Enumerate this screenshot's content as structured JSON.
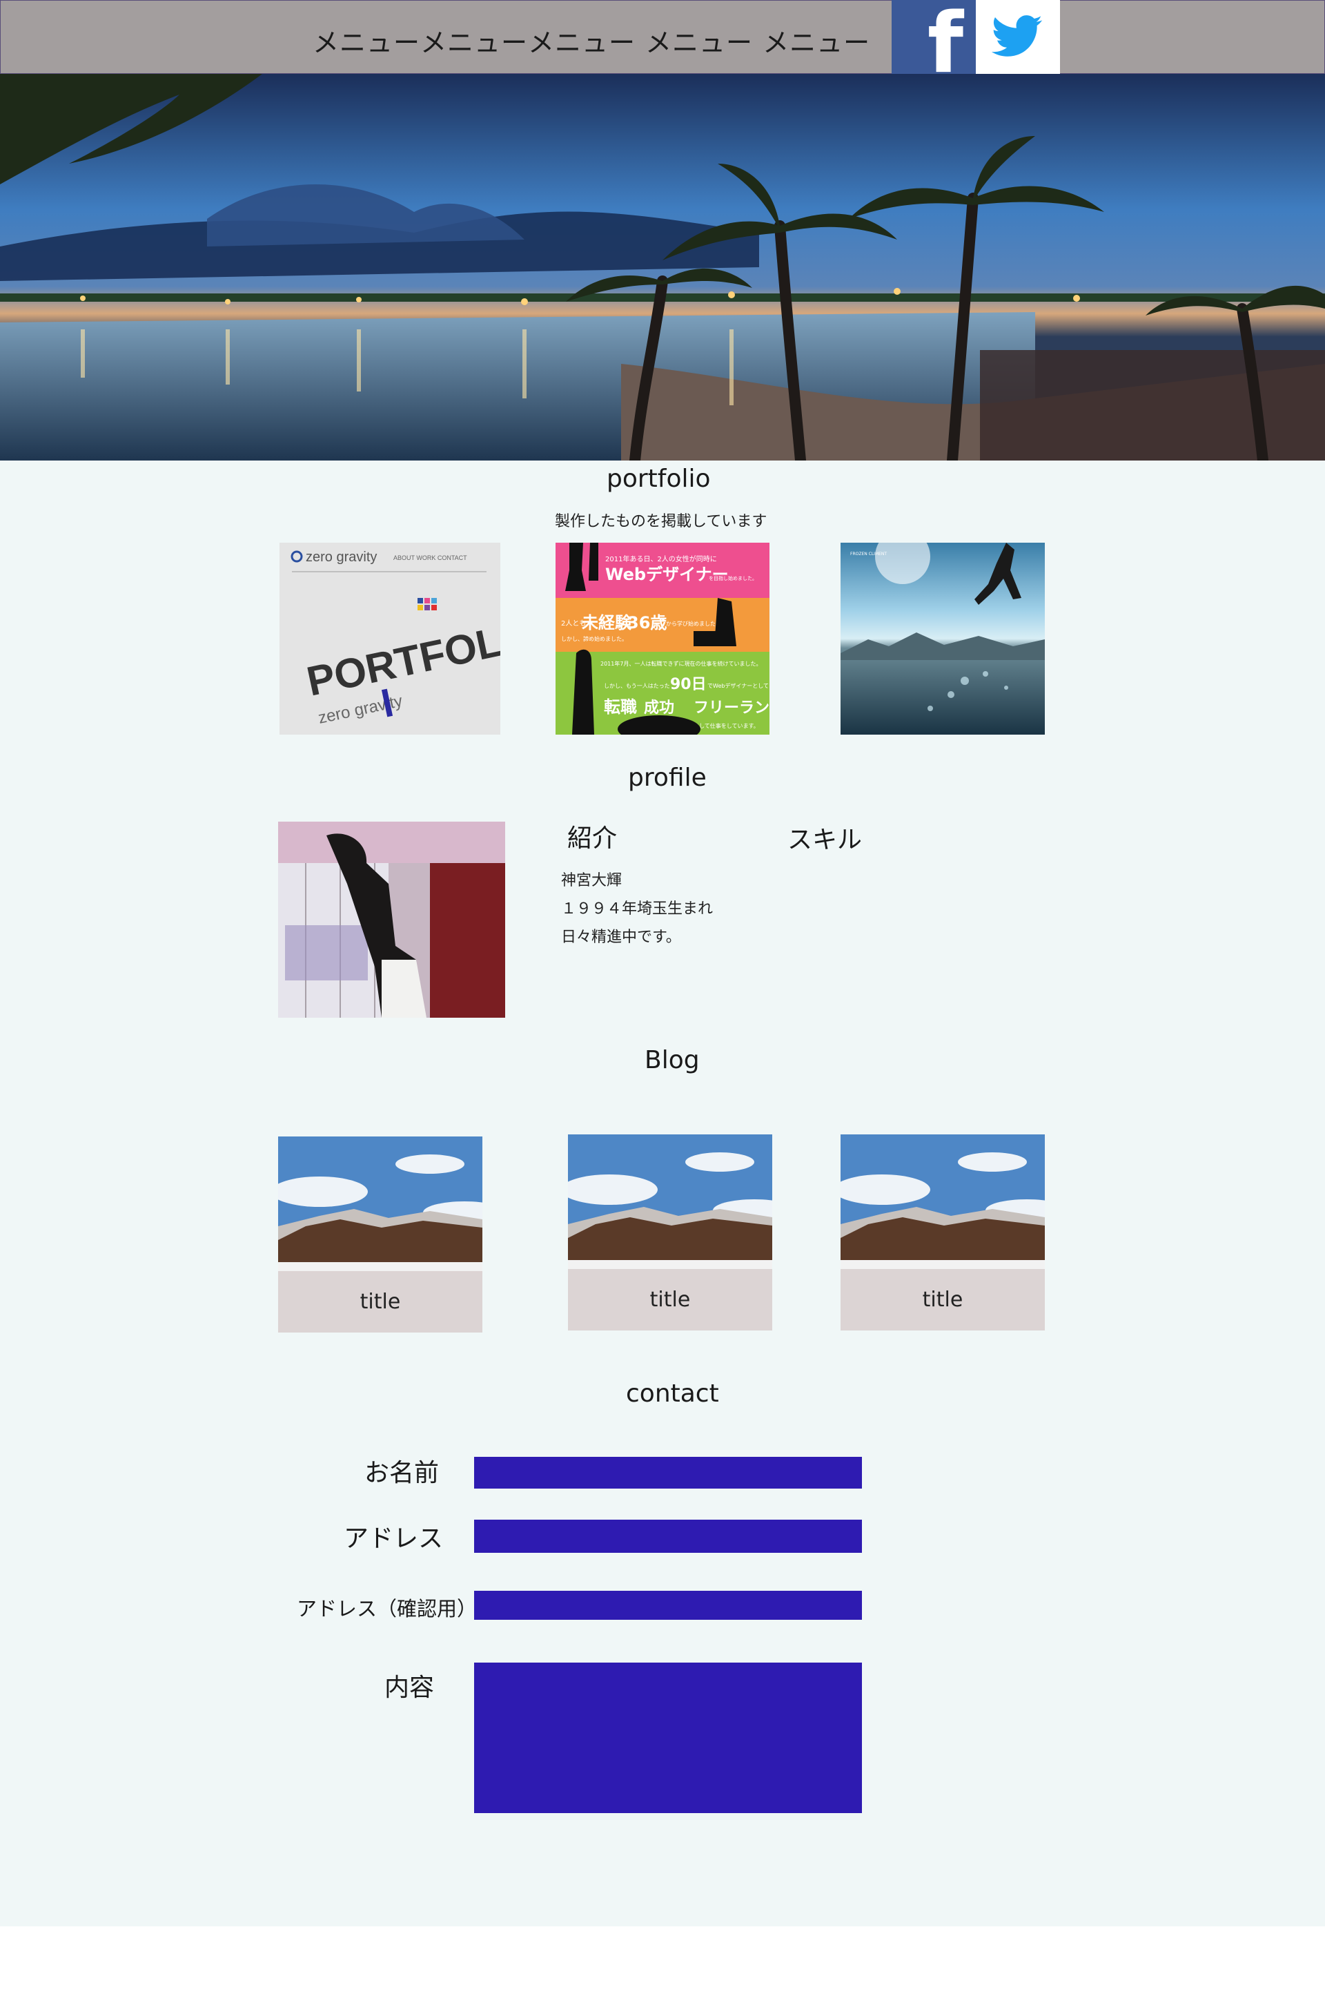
{
  "header": {
    "menu_items": [
      "メニュー",
      "メニュー",
      "メニュー",
      "メニュー",
      "メニュー"
    ],
    "social": [
      {
        "label": "f",
        "icon": "facebook-icon",
        "color": "#3b5998"
      },
      {
        "label": "",
        "icon": "twitter-icon",
        "color": "#1da1f2"
      }
    ],
    "background": "#a39e9e"
  },
  "hero": {
    "icon": "tropical-night-beach-photo"
  },
  "portfolio": {
    "title": "portfolio",
    "subtitle": "製作したものを掲載しています",
    "items": [
      {
        "brand": "zero gravity",
        "heading": "PORTFOLIO",
        "sub": "zero gravity",
        "nav": "ABOUT  WORK  CONTACT"
      },
      {
        "line1": "2011年ある日、2人の女性が同時に",
        "line2": "Webデザイナー",
        "line3": "を目指し始めました。",
        "line4": "2人とも",
        "line5": "未経験",
        "line6": "36歳",
        "line7": "から学び始めました",
        "line8": "しかし、諦め始めました。",
        "line9": "2011年7月、一人は転職できずに現在の仕事を続けていました。",
        "line10": "しかし、もう一人はたった",
        "line11": "90日",
        "line12": "でWebデザイナーとして",
        "line13": "転職",
        "line14": "成功",
        "line15": "フリーランス",
        "line16": "として仕事をしています。"
      },
      {
        "caption": "FROZEN CLIMENT"
      }
    ]
  },
  "profile": {
    "title": "profile",
    "intro_heading": "紹介",
    "skill_heading": "スキル",
    "intro_lines": [
      "神宮大輝",
      "１９９４年埼玉生まれ",
      "日々精進中です。"
    ]
  },
  "blog": {
    "title": "Blog",
    "cards": [
      {
        "title": "title"
      },
      {
        "title": "title"
      },
      {
        "title": "title"
      }
    ]
  },
  "contact": {
    "title": "contact",
    "fields": [
      {
        "label": "お名前",
        "value": ""
      },
      {
        "label": "アドレス",
        "value": ""
      },
      {
        "label": "アドレス（確認用）",
        "value": ""
      },
      {
        "label": "内容",
        "value": ""
      }
    ],
    "field_color": "#2e1bb1"
  }
}
